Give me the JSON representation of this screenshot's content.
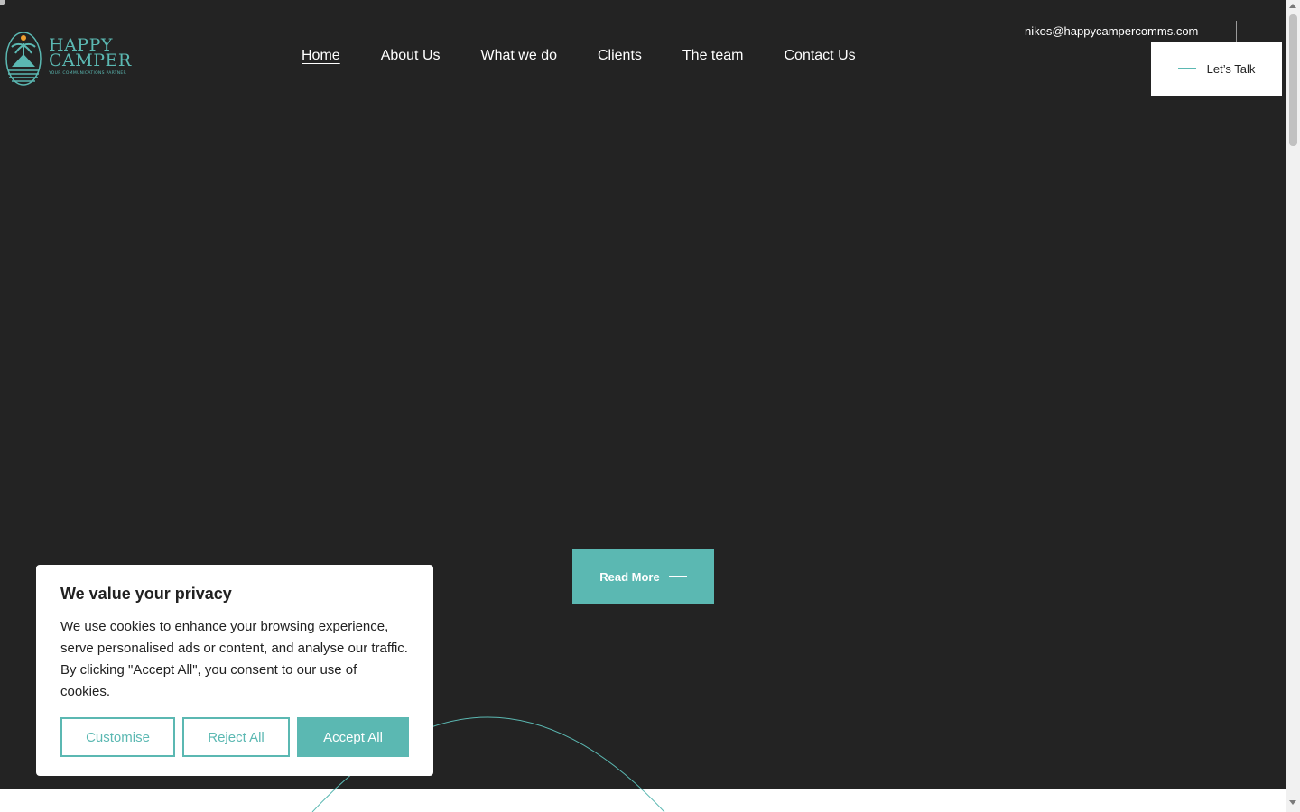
{
  "brand": {
    "name_line1": "HAPPY",
    "name_line2": "CAMPER",
    "tagline": "YOUR COMMUNICATIONS PARTNER",
    "accent_color": "#5bb8b2"
  },
  "nav": {
    "items": [
      {
        "label": "Home",
        "active": true
      },
      {
        "label": "About Us"
      },
      {
        "label": "What we do"
      },
      {
        "label": "Clients"
      },
      {
        "label": "The team"
      },
      {
        "label": "Contact Us"
      }
    ]
  },
  "header": {
    "email": "nikos@happycampercomms.com",
    "cta_label": "Let’s Talk"
  },
  "hero": {
    "read_more_label": "Read More"
  },
  "cookie": {
    "title": "We value your privacy",
    "body": "We use cookies to enhance your browsing experience, serve personalised ads or content, and analyse our traffic. By clicking \"Accept All\", you consent to our use of cookies.",
    "customise_label": "Customise",
    "reject_label": "Reject All",
    "accept_label": "Accept All"
  },
  "icons": [
    "palm-tree-logo-icon",
    "dash-line-icon",
    "scroll-up-arrow-icon",
    "scroll-down-arrow-icon"
  ]
}
